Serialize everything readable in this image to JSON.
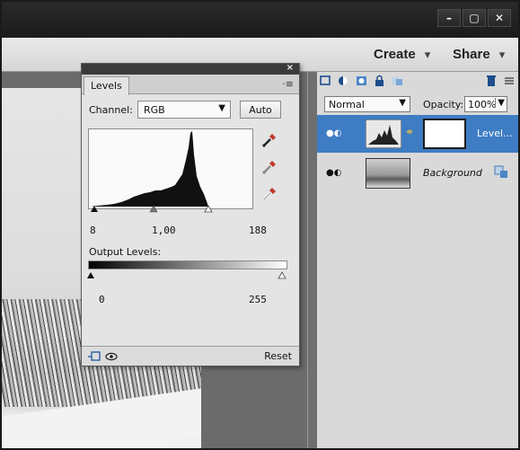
{
  "toolbar": {
    "create_label": "Create",
    "share_label": "Share",
    "chevron": "▾"
  },
  "window": {
    "minimize": "–",
    "restore": "▢",
    "close": "✕"
  },
  "levels": {
    "tab_label": "Levels",
    "panel_close": "×",
    "menu": "·≡",
    "channel_label": "Channel:",
    "channel_value": "RGB",
    "auto_label": "Auto",
    "input_black": "8",
    "input_gamma": "1,00",
    "input_white": "188",
    "output_label": "Output Levels:",
    "output_black": "0",
    "output_white": "255",
    "reset_label": "Reset",
    "icons": [
      "black-point-eyedropper-icon",
      "gray-point-eyedropper-icon",
      "white-point-eyedropper-icon",
      "clip-to-layer-icon",
      "visibility-eye-icon"
    ]
  },
  "layers": {
    "blend_mode": "Normal",
    "opacity_label": "Opacity:",
    "opacity_value": "100%",
    "items": [
      {
        "name": "Level...",
        "selected": true
      },
      {
        "name": "Background",
        "selected": false
      }
    ]
  }
}
